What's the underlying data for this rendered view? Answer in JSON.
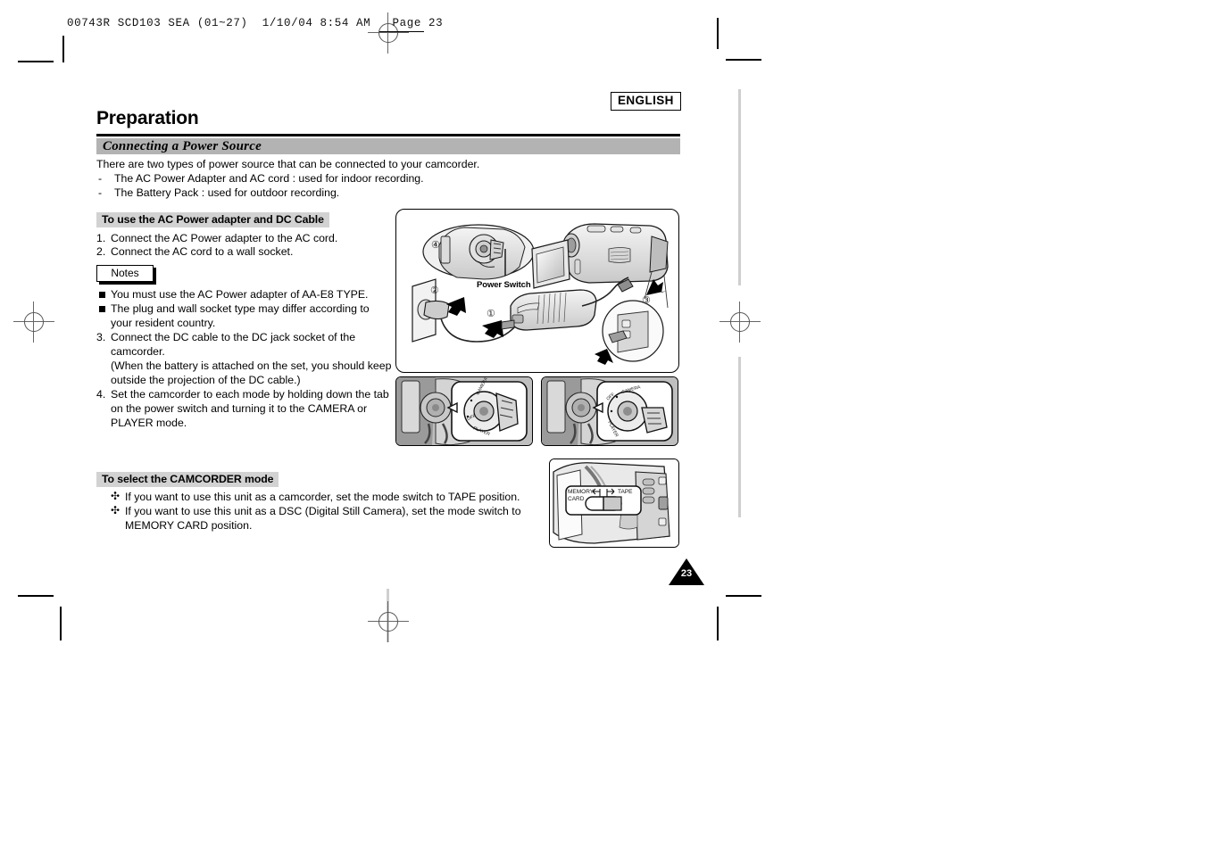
{
  "proof": {
    "header_line": "00743R SCD103 SEA (01~27)  1/10/04 8:54 AM   Page 23"
  },
  "page": {
    "language_badge": "ENGLISH",
    "title": "Preparation",
    "page_number": "23"
  },
  "section": {
    "bar_title": "Connecting a Power Source",
    "intro": "There are two types of power source that can be connected to your camcorder.",
    "dash_items": [
      {
        "dash": "-",
        "text": "The AC Power Adapter and AC cord : used for indoor recording."
      },
      {
        "dash": "-",
        "text": "The Battery Pack : used for outdoor recording."
      }
    ]
  },
  "ac_adapter": {
    "heading": "To use the AC Power adapter and DC Cable",
    "steps": [
      {
        "num": "1.",
        "text": "Connect the AC Power adapter to the AC cord."
      },
      {
        "num": "2.",
        "text": "Connect the AC cord to a wall socket."
      }
    ],
    "notes_label": "Notes",
    "note_bullets": [
      {
        "text": "You must use the AC Power adapter of AA-E8 TYPE."
      },
      {
        "text": "The plug and wall socket type may differ according to"
      }
    ],
    "note_bullet_2_cont": "your resident country.",
    "steps_cont": [
      {
        "num": "3.",
        "text": "Connect the DC cable to the DC jack socket of the"
      },
      {
        "num": "4.",
        "text": "Set the camcorder to each mode by holding down the tab"
      }
    ],
    "step3_lines": [
      "camcorder.",
      "(When the battery is attached on the set, you should keep",
      "outside the projection of the DC cable.)"
    ],
    "step4_lines": [
      "on the power switch and turning it to the CAMERA or",
      "PLAYER mode."
    ]
  },
  "camcorder_mode": {
    "heading": "To select the CAMCORDER mode",
    "bullets": [
      {
        "glyph": "✣",
        "text": "If you want to use this unit as a camcorder, set the mode switch to TAPE position."
      },
      {
        "glyph": "✣",
        "text": "If you want to use this unit as a DSC (Digital Still Camera), set the mode switch to"
      }
    ],
    "bullet_2_cont": "MEMORY CARD position."
  },
  "figures": {
    "main_diagram": {
      "power_switch_label": "Power Switch",
      "callouts": [
        "④",
        "②",
        "①",
        "③"
      ]
    },
    "dial_panels": {
      "labels": [
        "CAMERA",
        "OFF",
        "PLAYER"
      ]
    },
    "mode_panel": {
      "left_label_line1": "MEMORY",
      "left_label_line2": "CARD",
      "right_label": "TAPE"
    }
  }
}
